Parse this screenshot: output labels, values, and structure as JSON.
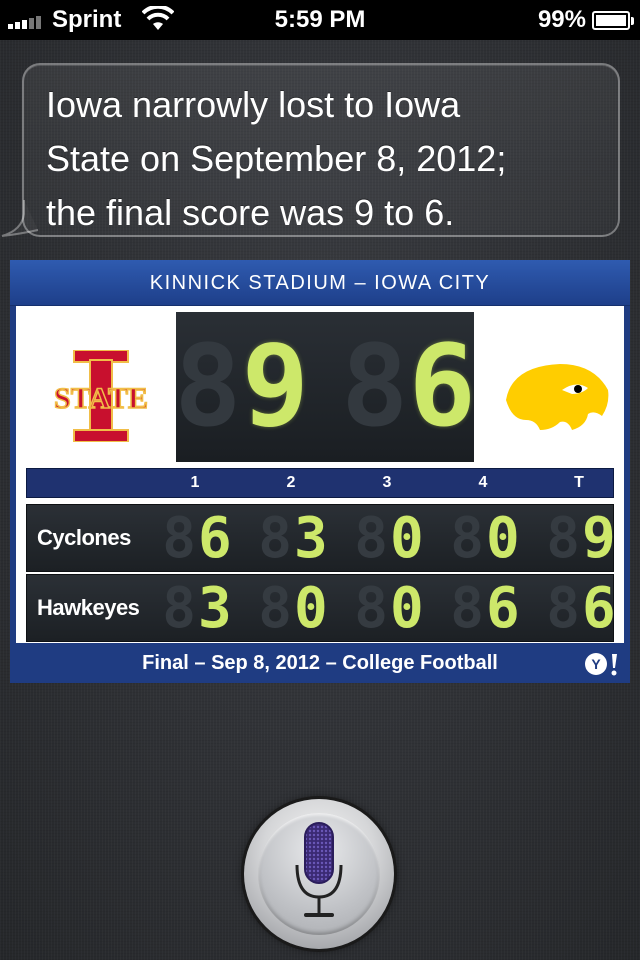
{
  "status_bar": {
    "carrier": "Sprint",
    "time": "5:59 PM",
    "battery_percent": "99%",
    "signal_bars": 4,
    "battery_level": 0.99
  },
  "siri": {
    "response": "Iowa narrowly lost to Iowa State on September 8, 2012; the final score was 9 to 6.",
    "lines": [
      "Iowa narrowly lost to Iowa",
      "State on September 8, 2012;",
      "the final score was 9 to 6."
    ]
  },
  "scoreboard": {
    "venue": "KINNICK STADIUM – IOWA CITY",
    "home_logo": "iowa-state-logo",
    "away_logo": "iowa-hawkeyes-logo",
    "score_left": "9",
    "score_right": "6",
    "quarter_headers": [
      "1",
      "2",
      "3",
      "4",
      "T"
    ],
    "teams": [
      {
        "name": "Cyclones",
        "scores": [
          "6",
          "3",
          "0",
          "0",
          "9"
        ]
      },
      {
        "name": "Hawkeyes",
        "scores": [
          "3",
          "0",
          "0",
          "6",
          "6"
        ]
      }
    ],
    "footer": "Final – Sep 8, 2012 – College Football",
    "provider_icon": "yahoo-icon",
    "colors": {
      "accent": "#1f3c82",
      "digit": "#cde86a",
      "isu_red": "#c8102e",
      "isu_gold": "#f1be48",
      "iowa_gold": "#ffcd00"
    }
  },
  "mic": {
    "icon": "microphone-icon"
  }
}
